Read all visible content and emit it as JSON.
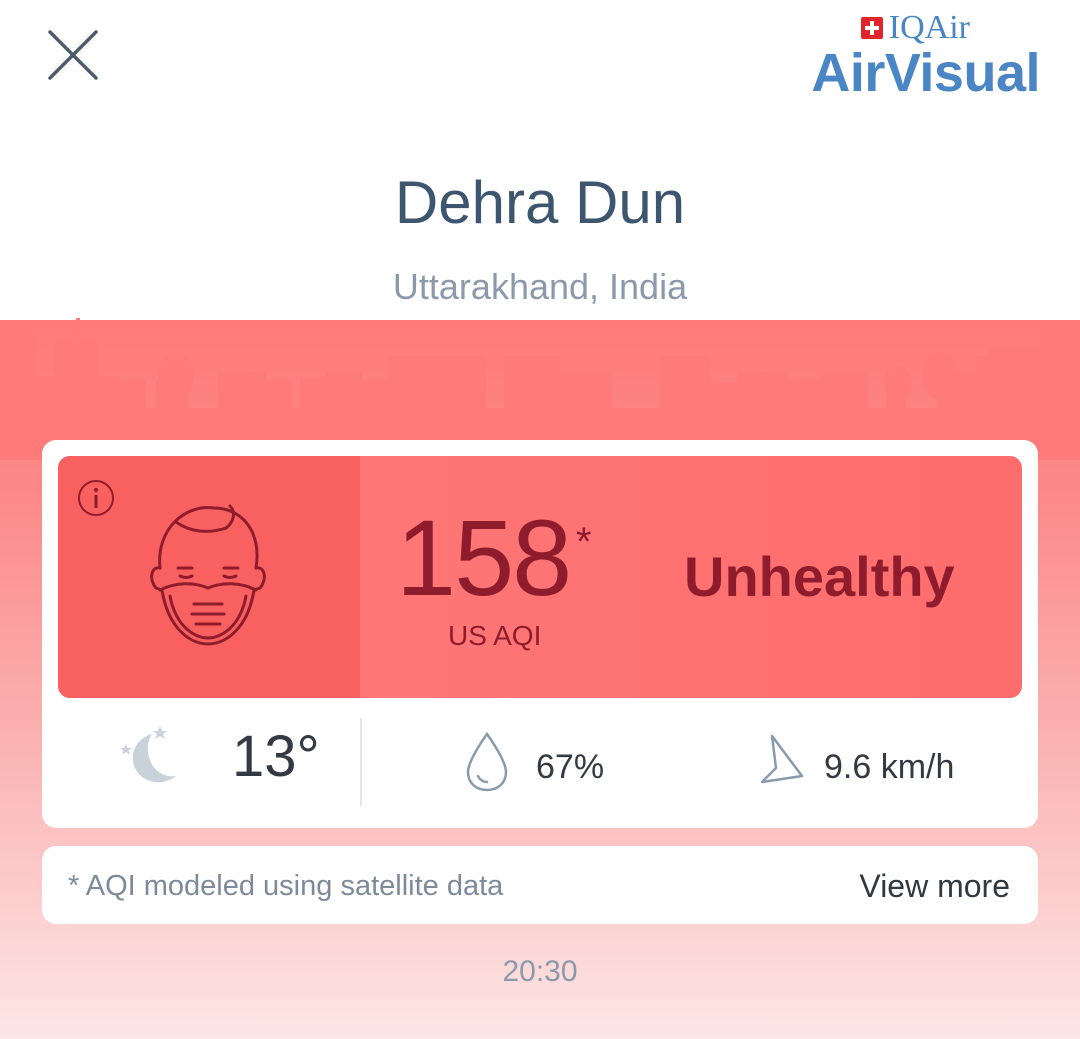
{
  "header": {
    "close_icon": "close-icon",
    "logo_brand": "IQAir",
    "logo_product": "AirVisual"
  },
  "location": {
    "city": "Dehra Dun",
    "region": "Uttarakhand, India"
  },
  "aqi": {
    "value": "158",
    "asterisk": "*",
    "unit": "US AQI",
    "status": "Unhealthy",
    "status_color": "#8f1c2c",
    "panel_color": "#fe7b7b"
  },
  "weather": {
    "condition_icon": "moon-icon",
    "temperature": "13°",
    "humidity_icon": "drop-icon",
    "humidity": "67%",
    "wind_icon": "wind-arrow-icon",
    "wind": "9.6 km/h"
  },
  "note": {
    "text": "* AQI modeled using satellite data",
    "action": "View more"
  },
  "footer": {
    "time": "20:30"
  }
}
